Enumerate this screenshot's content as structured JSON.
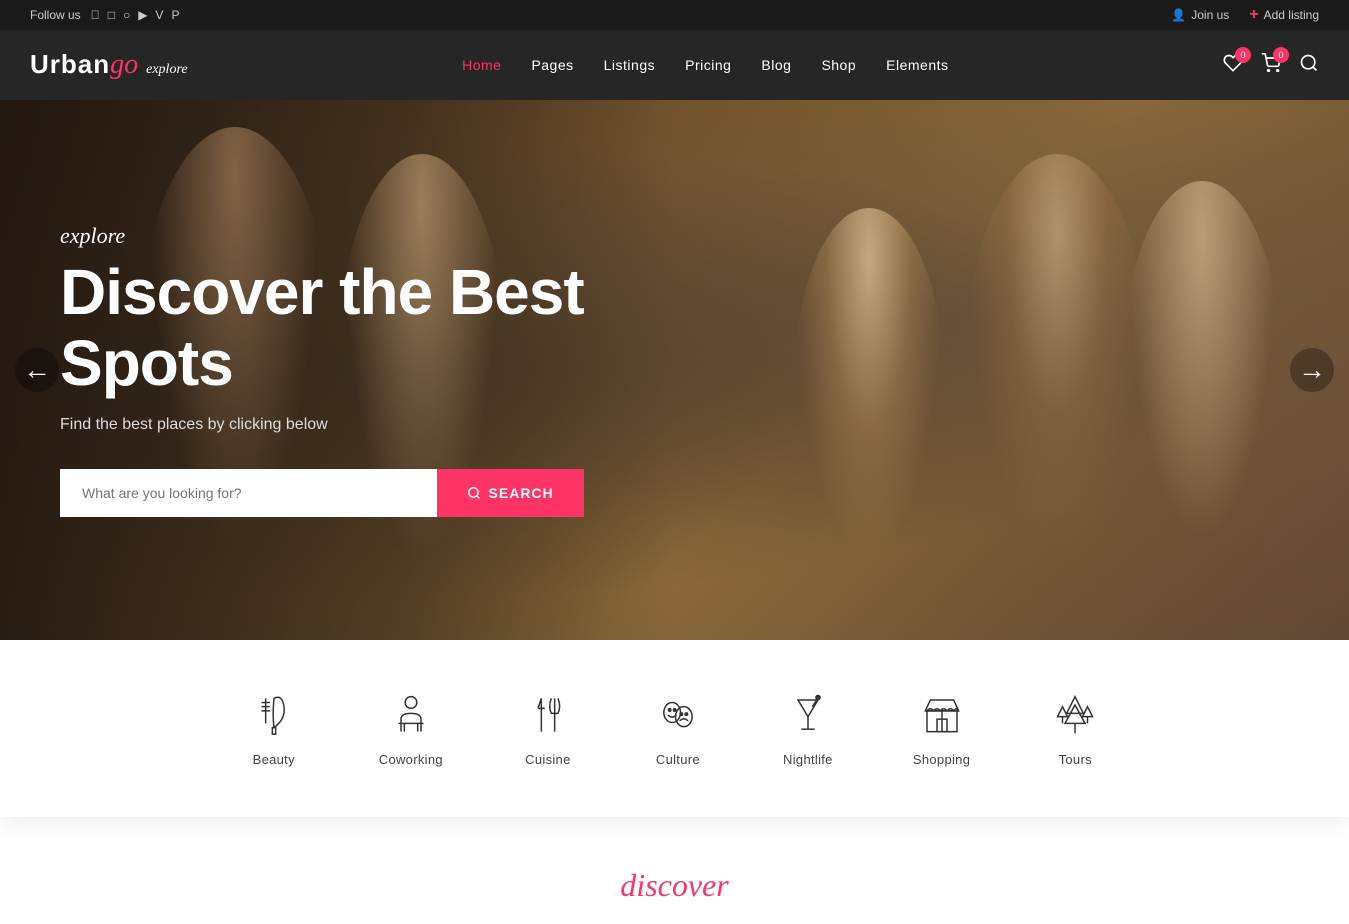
{
  "topbar": {
    "follow_label": "Follow us",
    "social_icons": [
      {
        "name": "facebook-icon",
        "symbol": "f"
      },
      {
        "name": "instagram-icon",
        "symbol": "in"
      },
      {
        "name": "tripadvisor-icon",
        "symbol": "ta"
      },
      {
        "name": "youtube-icon",
        "symbol": "yt"
      },
      {
        "name": "vimeo-icon",
        "symbol": "vi"
      },
      {
        "name": "pinterest-icon",
        "symbol": "pi"
      }
    ],
    "join_label": "Join us",
    "add_listing_label": "Add listing"
  },
  "header": {
    "logo_urban": "Urban",
    "logo_go": "go",
    "logo_explore": "explore",
    "nav_items": [
      {
        "label": "Home",
        "active": true
      },
      {
        "label": "Pages",
        "active": false
      },
      {
        "label": "Listings",
        "active": false
      },
      {
        "label": "Pricing",
        "active": false
      },
      {
        "label": "Blog",
        "active": false
      },
      {
        "label": "Shop",
        "active": false
      },
      {
        "label": "Elements",
        "active": false
      }
    ],
    "wishlist_count": "0",
    "cart_count": "0"
  },
  "hero": {
    "explore_label": "explore",
    "title_line1": "Discover the Best",
    "title_line2": "Spots",
    "subtitle": "Find the best places by clicking below",
    "search_placeholder": "What are you looking for?",
    "search_btn_label": "SEARCH",
    "prev_arrow": "←",
    "next_arrow": "→"
  },
  "categories": [
    {
      "id": "beauty",
      "label": "Beauty",
      "icon": "scissors"
    },
    {
      "id": "coworking",
      "label": "Coworking",
      "icon": "desk"
    },
    {
      "id": "cuisine",
      "label": "Cuisine",
      "icon": "fork"
    },
    {
      "id": "culture",
      "label": "Culture",
      "icon": "masks"
    },
    {
      "id": "nightlife",
      "label": "Nightlife",
      "icon": "cocktail"
    },
    {
      "id": "shopping",
      "label": "Shopping",
      "icon": "store"
    },
    {
      "id": "tours",
      "label": "Tours",
      "icon": "trees"
    }
  ],
  "discover": {
    "script_label": "discover"
  }
}
